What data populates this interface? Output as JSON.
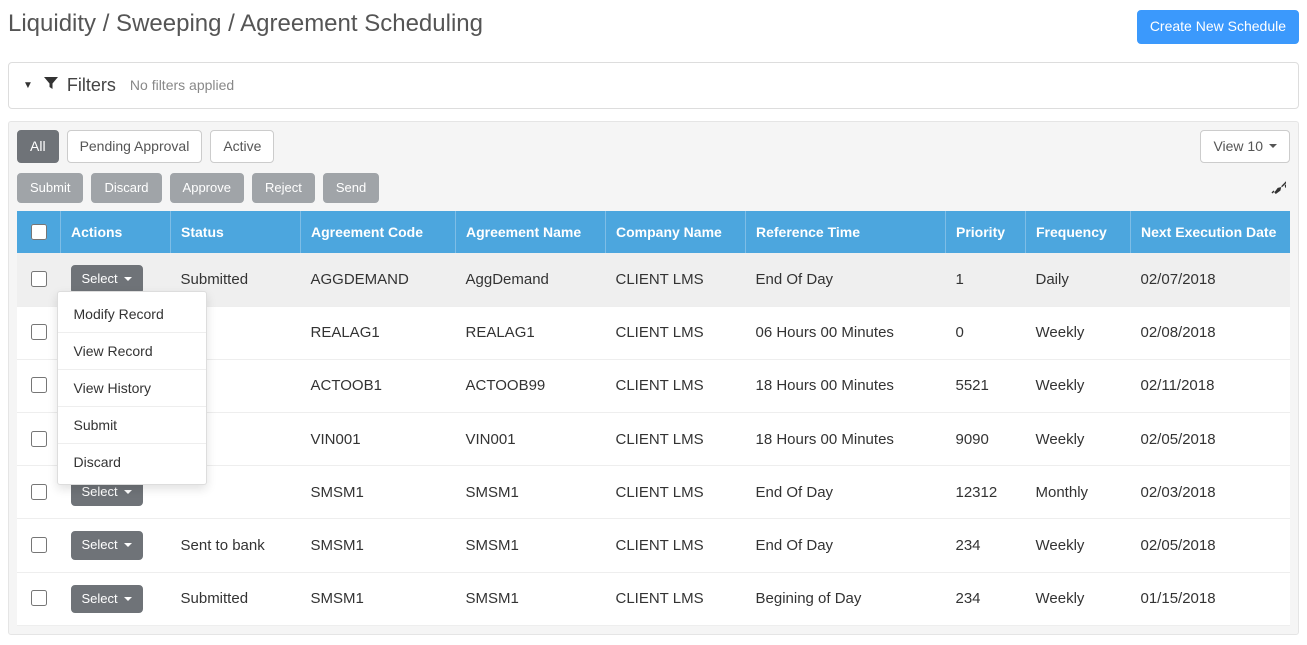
{
  "header": {
    "breadcrumb": "Liquidity / Sweeping / Agreement Scheduling",
    "create_button": "Create New Schedule"
  },
  "filters": {
    "title": "Filters",
    "status_text": "No filters applied"
  },
  "tabs": {
    "all": "All",
    "pending": "Pending Approval",
    "active": "Active",
    "view_label": "View 10"
  },
  "actions": {
    "submit": "Submit",
    "discard": "Discard",
    "approve": "Approve",
    "reject": "Reject",
    "send": "Send"
  },
  "grid": {
    "select_label": "Select",
    "columns": {
      "actions": "Actions",
      "status": "Status",
      "agreement_code": "Agreement Code",
      "agreement_name": "Agreement Name",
      "company_name": "Company Name",
      "reference_time": "Reference Time",
      "priority": "Priority",
      "frequency": "Frequency",
      "next_exec": "Next Execution Date"
    },
    "rows": [
      {
        "status": "Submitted",
        "code": "AGGDEMAND",
        "name": "AggDemand",
        "company": "CLIENT LMS",
        "ref": "End Of Day",
        "priority": "1",
        "freq": "Daily",
        "next": "02/07/2018",
        "selected": true
      },
      {
        "status": "",
        "code": "REALAG1",
        "name": "REALAG1",
        "company": "CLIENT LMS",
        "ref": "06 Hours 00 Minutes",
        "priority": "0",
        "freq": "Weekly",
        "next": "02/08/2018",
        "selected": false
      },
      {
        "status": "",
        "code": "ACTOOB1",
        "name": "ACTOOB99",
        "company": "CLIENT LMS",
        "ref": "18 Hours 00 Minutes",
        "priority": "5521",
        "freq": "Weekly",
        "next": "02/11/2018",
        "selected": false
      },
      {
        "status": "",
        "code": "VIN001",
        "name": "VIN001",
        "company": "CLIENT LMS",
        "ref": "18 Hours 00 Minutes",
        "priority": "9090",
        "freq": "Weekly",
        "next": "02/05/2018",
        "selected": false
      },
      {
        "status": "",
        "code": "SMSM1",
        "name": "SMSM1",
        "company": "CLIENT LMS",
        "ref": "End Of Day",
        "priority": "12312",
        "freq": "Monthly",
        "next": "02/03/2018",
        "selected": false
      },
      {
        "status": "Sent to bank",
        "code": "SMSM1",
        "name": "SMSM1",
        "company": "CLIENT LMS",
        "ref": "End Of Day",
        "priority": "234",
        "freq": "Weekly",
        "next": "02/05/2018",
        "selected": false
      },
      {
        "status": "Submitted",
        "code": "SMSM1",
        "name": "SMSM1",
        "company": "CLIENT LMS",
        "ref": "Begining of Day",
        "priority": "234",
        "freq": "Weekly",
        "next": "01/15/2018",
        "selected": false
      }
    ]
  },
  "dropdown": {
    "modify": "Modify Record",
    "view": "View Record",
    "history": "View History",
    "submit": "Submit",
    "discard": "Discard"
  }
}
